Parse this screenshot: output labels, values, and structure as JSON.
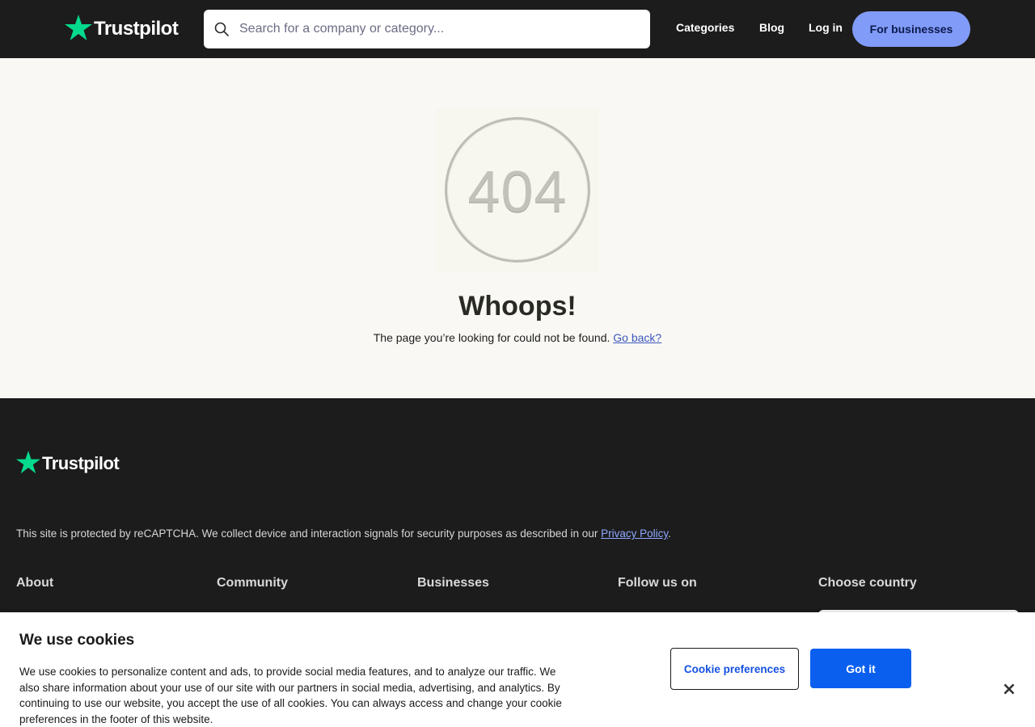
{
  "header": {
    "brand": "Trustpilot",
    "search_placeholder": "Search for a company or category...",
    "nav": [
      "Categories",
      "Blog",
      "Log in"
    ],
    "business_button": "For businesses",
    "colors": {
      "background": "#1c1c1c",
      "star": "#04da8d",
      "business_button": "#819bf8"
    }
  },
  "main": {
    "error_code": "404",
    "title": "Whoops!",
    "message": "The page you’re looking for could not be found.",
    "back_link": "Go back?"
  },
  "footer": {
    "brand": "Trustpilot",
    "recaptcha_text": "This site is protected by reCAPTCHA. We collect device and interaction signals for security purposes as described in our ",
    "privacy_link": "Privacy Policy",
    "recaptcha_end": ".",
    "columns": [
      "About",
      "Community",
      "Businesses",
      "Follow us on",
      "Choose country"
    ]
  },
  "cookie_banner": {
    "title": "We use cookies",
    "body": "We use cookies to personalize content and ads, to provide social media features, and to analyze our traffic. We also share information about your use of our site with our partners in social media, advertising, and analytics. By continuing to use our website, you accept the use of all cookies. You can always access and change your cookie preferences in the footer of this website.",
    "preferences_button": "Cookie preferences",
    "accept_button": "Got it",
    "close_icon": "×",
    "colors": {
      "accept": "#0b5fef",
      "link": "#1551e0"
    }
  }
}
